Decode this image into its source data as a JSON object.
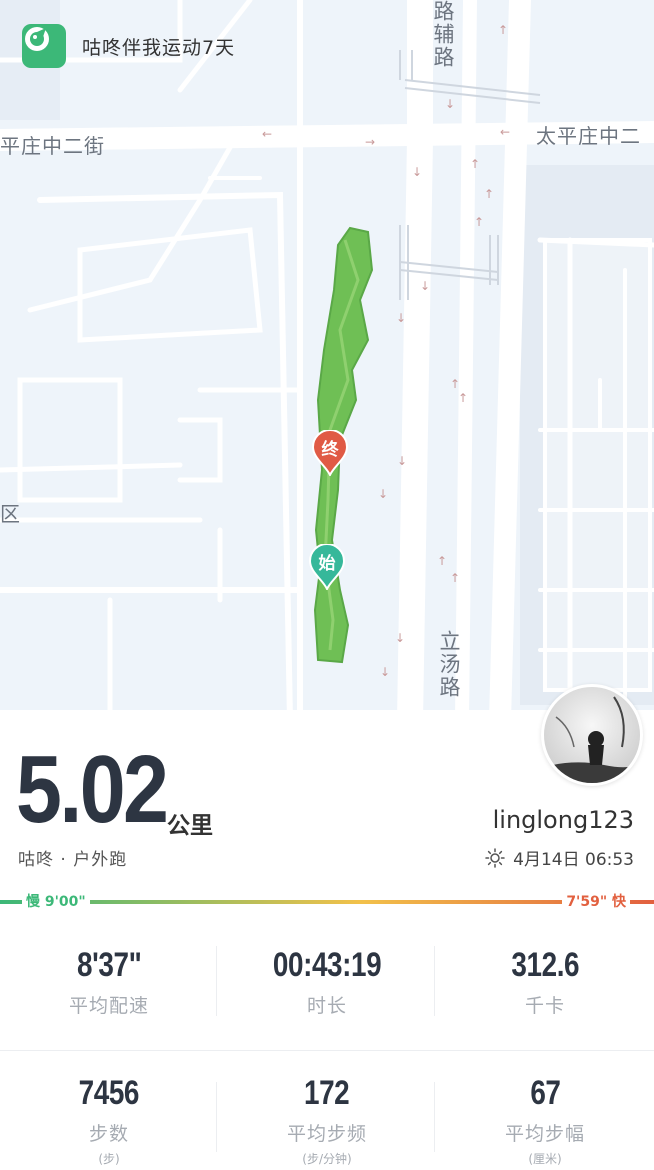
{
  "banner": {
    "text": "咕咚伴我运动7天",
    "icon": "codoon-logo-icon"
  },
  "map": {
    "labels": {
      "road_top": "路辅路",
      "street_left": "平庄中二街",
      "street_right": "太平庄中二",
      "district": "区",
      "road_bottom": "立汤路"
    },
    "start_label": "始",
    "end_label": "终"
  },
  "summary": {
    "distance": "5.02",
    "distance_unit": "公里",
    "activity": "咕咚 · 户外跑",
    "username": "linglong123",
    "date": "4月14日 06:53",
    "weather_icon": "sun-icon"
  },
  "pace": {
    "slow_label": "慢 9'00\"",
    "fast_label": "7'59\" 快",
    "colors": [
      "#3cb878",
      "#f2c14a",
      "#e2603f"
    ]
  },
  "stats": [
    {
      "value": "8'37\"",
      "label": "平均配速"
    },
    {
      "value": "00:43:19",
      "label": "时长"
    },
    {
      "value": "312.6",
      "label": "千卡"
    },
    {
      "value": "7456",
      "label": "步数",
      "unit": "(步)"
    },
    {
      "value": "172",
      "label": "平均步频",
      "unit": "(步/分钟)"
    },
    {
      "value": "67",
      "label": "平均步幅",
      "unit": "(厘米)"
    }
  ]
}
